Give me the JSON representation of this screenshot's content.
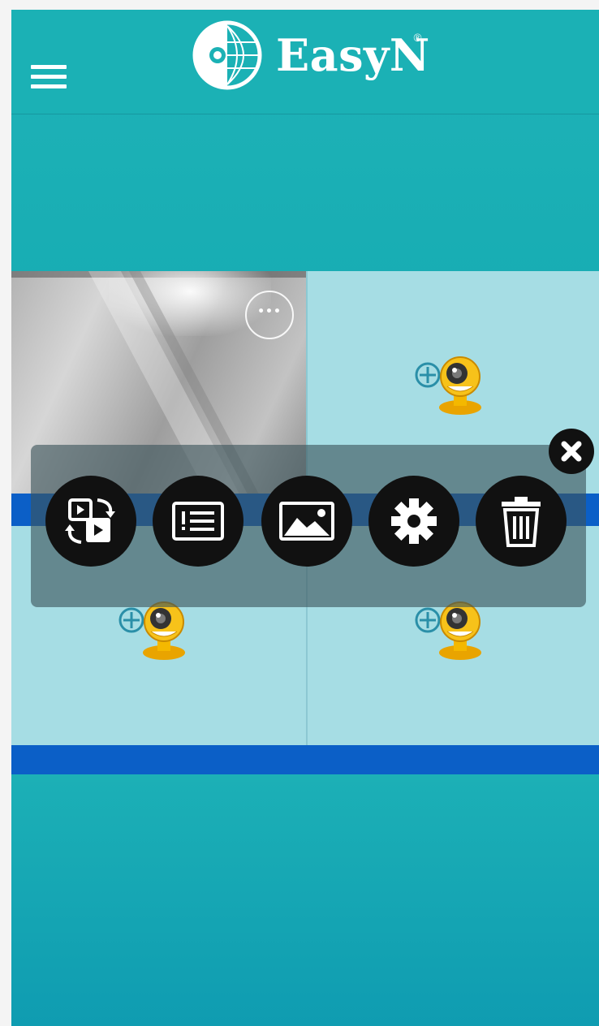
{
  "header": {
    "logo_text": "EasyN",
    "logo_mark": "®",
    "menu_icon": "hamburger-menu-icon",
    "logo_icon": "globe-logo-icon"
  },
  "colors": {
    "header": "#1bb1b5",
    "grid_cell": "#a6dde4",
    "highlight_bar": "#0b5fc7",
    "overlay": "#3c545a",
    "action_button": "#111111"
  },
  "grid": {
    "cells": [
      {
        "name": "camera-feed",
        "has_video": true,
        "more_icon": "more-dots-icon"
      },
      {
        "name": "add-camera-slot",
        "add_icon": "add-camera-icon"
      },
      {
        "name": "add-camera-slot",
        "add_icon": "add-camera-icon"
      },
      {
        "name": "add-camera-slot",
        "add_icon": "add-camera-icon"
      }
    ],
    "more_label": "•••"
  },
  "action_menu": {
    "close_icon": "close-icon",
    "actions": [
      {
        "id": "switch-view",
        "icon": "switch-view-icon"
      },
      {
        "id": "event-list",
        "icon": "alarm-list-icon"
      },
      {
        "id": "gallery",
        "icon": "image-gallery-icon"
      },
      {
        "id": "settings",
        "icon": "gear-icon"
      },
      {
        "id": "delete",
        "icon": "trash-icon"
      }
    ]
  }
}
